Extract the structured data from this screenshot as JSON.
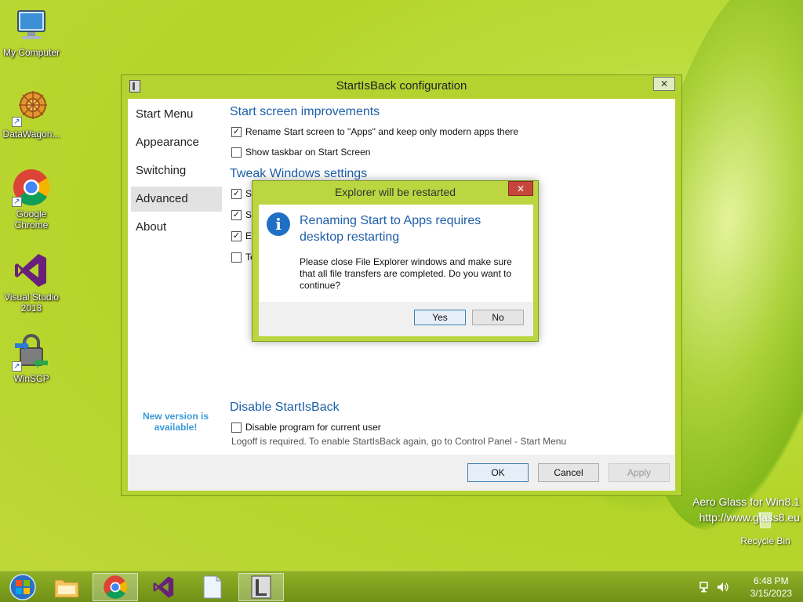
{
  "desktop": {
    "icons": [
      {
        "label": "My Computer"
      },
      {
        "label": "DataWagon..."
      },
      {
        "label": "Google Chrome"
      },
      {
        "label": "Visual Studio 2013"
      },
      {
        "label": "WinSCP"
      }
    ],
    "recycle_bin": "Recycle Bin",
    "watermark": {
      "line1": "Aero Glass for Win8.1",
      "line2": "http://www.glass8.eu"
    }
  },
  "config_window": {
    "title": "StartIsBack configuration",
    "close_glyph": "✕",
    "nav": [
      {
        "label": "Start Menu"
      },
      {
        "label": "Appearance"
      },
      {
        "label": "Switching"
      },
      {
        "label": "Advanced",
        "active": true
      },
      {
        "label": "About"
      }
    ],
    "new_version": "New version is available!",
    "sections": {
      "start_screen": {
        "title": "Start screen improvements",
        "options": [
          {
            "label": "Rename Start screen to \"Apps\" and keep only modern apps there",
            "checked": true
          },
          {
            "label": "Show taskbar on Start Screen",
            "checked": false
          }
        ]
      },
      "tweak": {
        "title": "Tweak Windows settings",
        "options": [
          {
            "label": "St",
            "checked": true
          },
          {
            "label": "St",
            "checked": true
          },
          {
            "label": "En",
            "checked": true
          },
          {
            "label": "Te",
            "checked": false
          }
        ]
      },
      "disable": {
        "title": "Disable StartIsBack",
        "option": {
          "label": "Disable program for current user",
          "checked": false
        },
        "note": "Logoff is required. To enable StartIsBack again, go to Control Panel - Start Menu"
      }
    },
    "buttons": {
      "ok": "OK",
      "cancel": "Cancel",
      "apply": "Apply"
    }
  },
  "dialog": {
    "title": "Explorer will be restarted",
    "close_glyph": "✕",
    "heading": "Renaming Start to Apps requires desktop restarting",
    "text": "Please close File Explorer windows and make sure that all file transfers are completed.  Do you want to continue?",
    "buttons": {
      "yes": "Yes",
      "no": "No"
    }
  },
  "taskbar": {
    "items": [
      {
        "icon": "start-orb-icon"
      },
      {
        "icon": "file-explorer-icon"
      },
      {
        "icon": "chrome-icon",
        "active": true
      },
      {
        "icon": "visual-studio-icon"
      },
      {
        "icon": "notepad-icon"
      },
      {
        "icon": "startisback-config-icon",
        "active": true
      }
    ],
    "clock": {
      "time": "6:48 PM",
      "date": "3/15/2023"
    }
  },
  "colors": {
    "accent": "#1e5fa8",
    "glass": "#b4d230",
    "close_red": "#c7463c"
  }
}
